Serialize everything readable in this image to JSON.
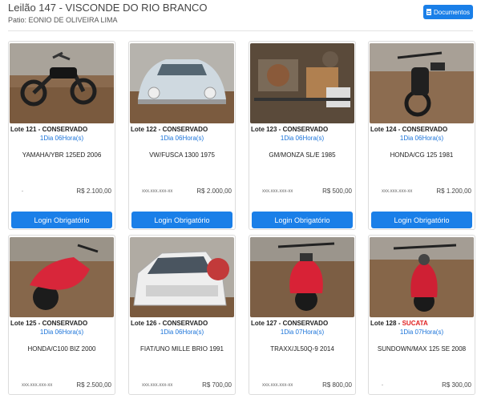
{
  "header": {
    "title": "Leilão 147 - VISCONDE DO RIO BRANCO",
    "subtitle": "Patio: EONIO DE OLIVEIRA LIMA",
    "documents_button": "Documentos"
  },
  "lots": [
    {
      "lot": "Lote 121 - CONSERVADO",
      "status": "CONSERVADO",
      "time": "1Dia 06Hora(s)",
      "desc": "YAMAHA/YBR 125ED 2006",
      "bidder": "-",
      "price": "R$ 2.100,00",
      "button": "Login Obrigatório",
      "photo": "motorcycle-black"
    },
    {
      "lot": "Lote 122 - CONSERVADO",
      "status": "CONSERVADO",
      "time": "1Dia 06Hora(s)",
      "desc": "VW/FUSCA 1300 1975",
      "bidder": "xxx.xxx.xxx-xx",
      "price": "R$ 2.000,00",
      "button": "Login Obrigatório",
      "photo": "beetle-car"
    },
    {
      "lot": "Lote 123 - CONSERVADO",
      "status": "CONSERVADO",
      "time": "1Dia 06Hora(s)",
      "desc": "GM/MONZA SL/E 1985",
      "bidder": "xxx.xxx.xxx-xx",
      "price": "R$ 500,00",
      "button": "Login Obrigatório",
      "photo": "engine-bay"
    },
    {
      "lot": "Lote 124 - CONSERVADO",
      "status": "CONSERVADO",
      "time": "1Dia 06Hora(s)",
      "desc": "HONDA/CG 125 1981",
      "bidder": "xxx.xxx.xxx-xx",
      "price": "R$ 1.200,00",
      "button": "Login Obrigatório",
      "photo": "motorcycle-dark"
    },
    {
      "lot": "Lote 125 - CONSERVADO",
      "status": "CONSERVADO",
      "time": "1Dia 06Hora(s)",
      "desc": "HONDA/C100 BIZ 2000",
      "bidder": "xxx.xxx.xxx-xx",
      "price": "R$ 2.500,00",
      "button": "Login Obrigatório",
      "photo": "scooter-red"
    },
    {
      "lot": "Lote 126 - CONSERVADO",
      "status": "CONSERVADO",
      "time": "1Dia 06Hora(s)",
      "desc": "FIAT/UNO MILLE BRIO 1991",
      "bidder": "xxx.xxx.xxx-xx",
      "price": "R$ 700,00",
      "button": "Login Obrigatório",
      "photo": "white-car"
    },
    {
      "lot": "Lote 127 - CONSERVADO",
      "status": "CONSERVADO",
      "time": "1Dia 07Hora(s)",
      "desc": "TRAXX/JL50Q-9 2014",
      "bidder": "xxx.xxx.xxx-xx",
      "price": "R$ 800,00",
      "button": "Login Obrigatório",
      "photo": "scooter-red"
    },
    {
      "lot": "Lote 128 - SUCATA",
      "status": "SUCATA",
      "time": "1Dia 07Hora(s)",
      "desc": "SUNDOWN/MAX 125 SE 2008",
      "bidder": "-",
      "price": "R$ 300,00",
      "button": "Login Obrigatório",
      "photo": "motorcycle-red"
    }
  ],
  "colors": {
    "accent": "#1a7fe8",
    "link_blue": "#1a73d9",
    "scrap_red": "#e02020"
  }
}
